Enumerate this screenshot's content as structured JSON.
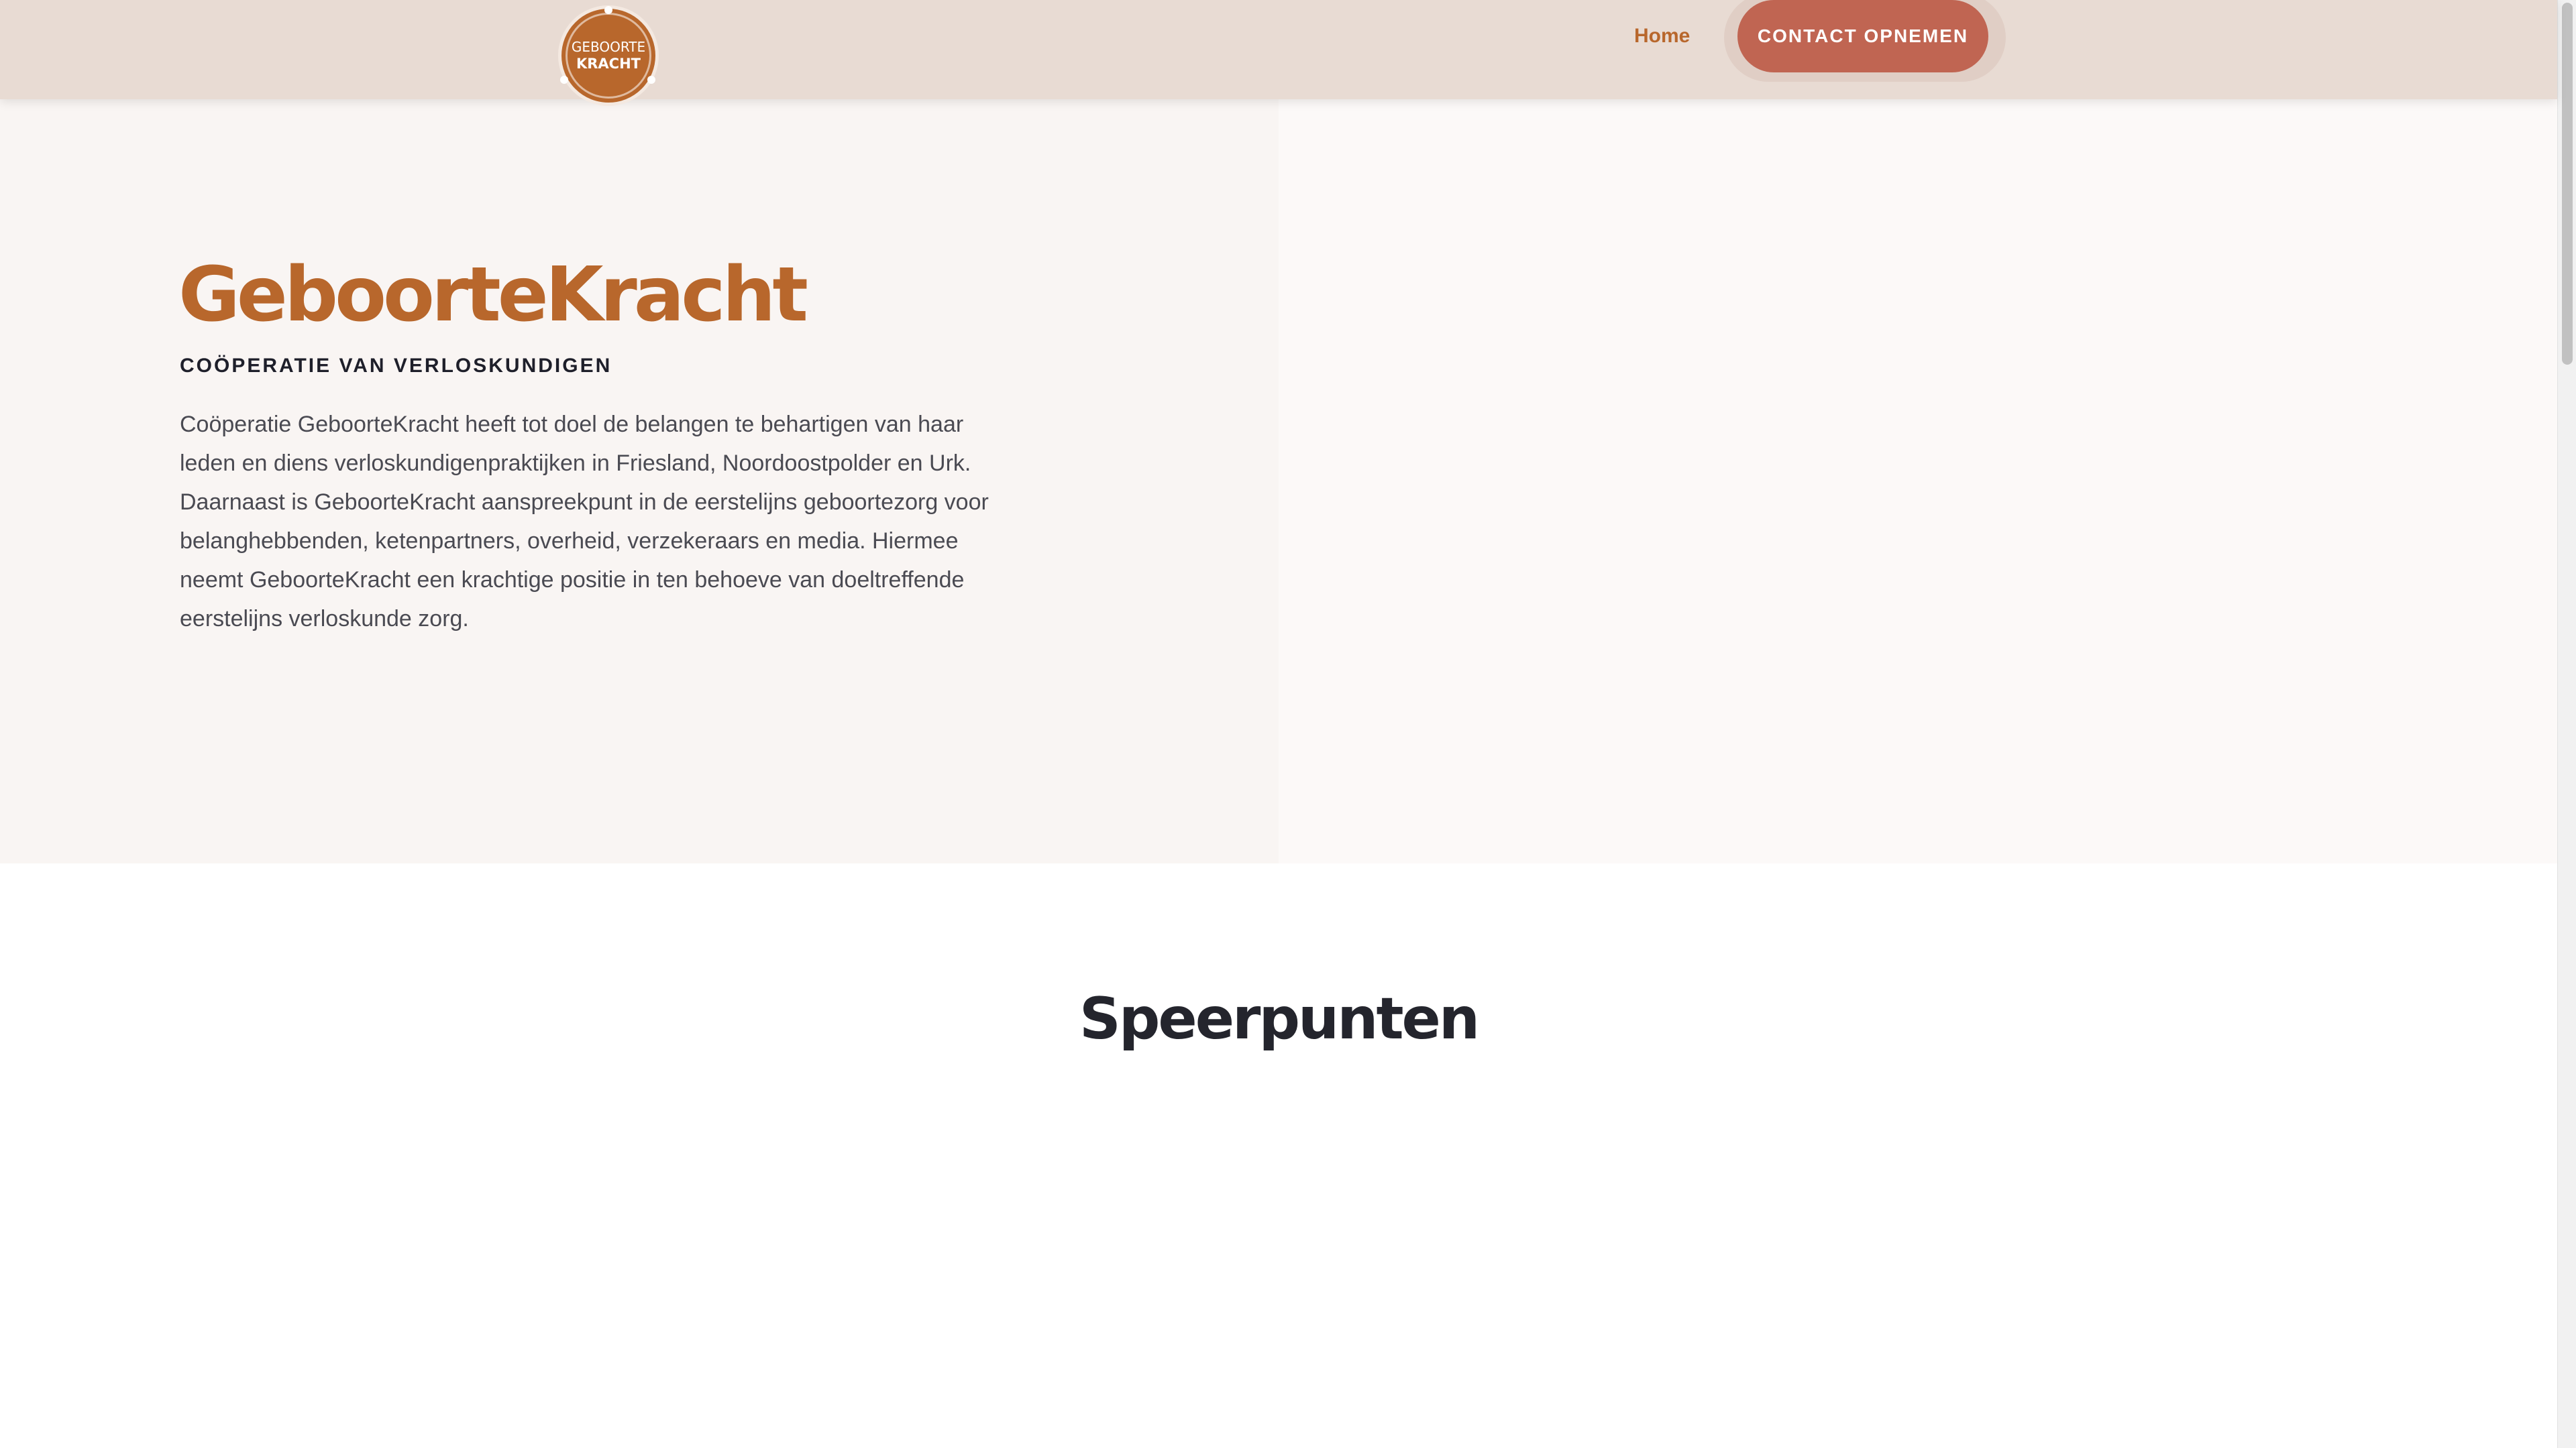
{
  "header": {
    "logo": {
      "line1": "GEBOORTE",
      "line2": "KRACHT",
      "color": "#b8672c"
    },
    "nav": {
      "home_label": "Home",
      "cta_label": "CONTACT OPNEMEN"
    }
  },
  "hero": {
    "title": "GeboorteKracht",
    "subtitle": "COÖPERATIE VAN VERLOSKUNDIGEN",
    "body": "Coöperatie GeboorteKracht heeft tot doel de belangen te behartigen van haar leden en diens verloskundigenpraktijken in Friesland, Noordoostpolder en Urk. Daarnaast is GeboorteKracht aanspreekpunt in de eerstelijns geboortezorg voor belanghebbenden, ketenpartners, overheid, verzekeraars en media. Hiermee neemt GeboorteKracht een krachtige positie in ten behoeve van doeltreffende eerstelijns verloskunde zorg."
  },
  "speerpunten": {
    "title": "Speerpunten"
  },
  "colors": {
    "brand": "#b8672c",
    "accent": "#c06552",
    "header_bg": "#e8dbd3"
  }
}
